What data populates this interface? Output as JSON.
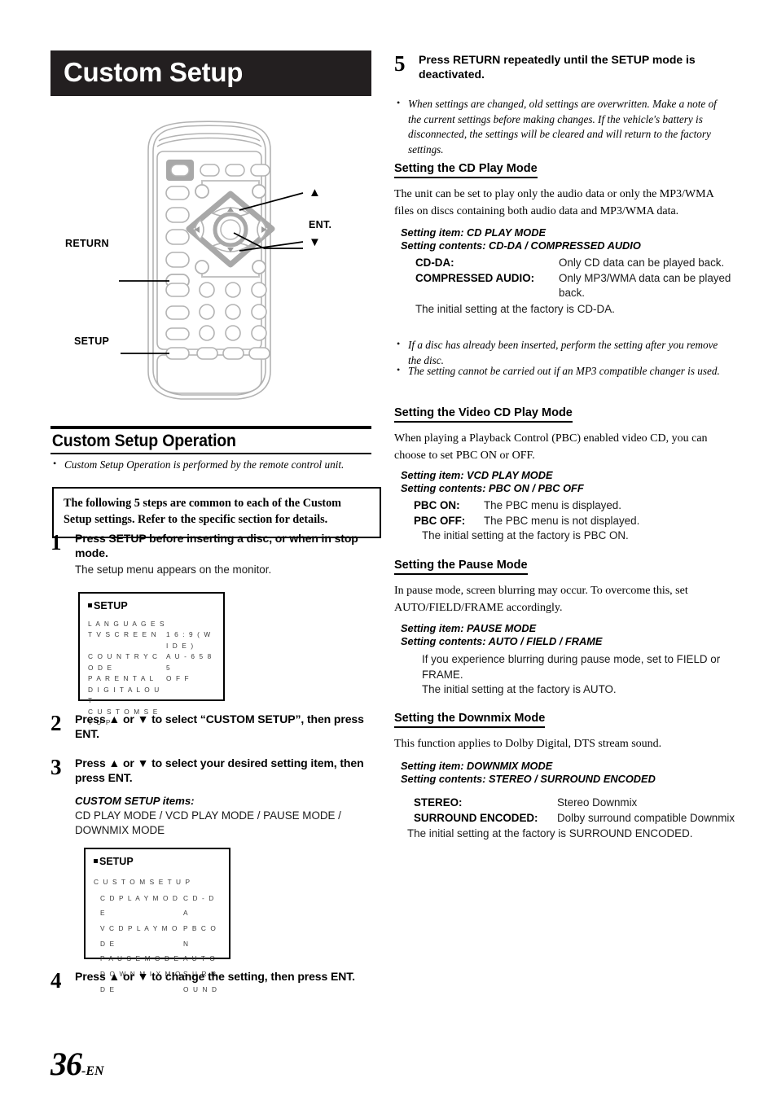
{
  "page": {
    "title": "Custom Setup",
    "page_number": "36",
    "page_suffix": "-EN"
  },
  "remote_diagram": {
    "labels": {
      "return": "RETURN",
      "setup": "SETUP",
      "up": "▲",
      "ent": "ENT.",
      "down": "▼"
    }
  },
  "section": {
    "heading": "Custom Setup Operation",
    "intro_note": "Custom Setup Operation is performed by the remote control unit.",
    "boxed_note": "The following 5 steps are common to each of the Custom Setup settings. Refer to the specific section for details."
  },
  "steps": [
    {
      "num": "1",
      "heading": "Press SETUP before inserting a disc, or when in stop mode.",
      "sub": "The setup menu appears on the monitor."
    },
    {
      "num": "2",
      "heading": "Press ▲ or ▼ to select “CUSTOM SETUP”, then press ENT."
    },
    {
      "num": "3",
      "heading": "Press ▲ or ▼ to select your desired setting item, then press ENT.",
      "items_label": "CUSTOM SETUP items:",
      "items": "CD PLAY MODE / VCD PLAY MODE / PAUSE MODE / DOWNMIX MODE"
    },
    {
      "num": "4",
      "heading": "Press ▲ or ▼ to change the setting, then press ENT."
    },
    {
      "num": "5",
      "heading": "Press RETURN repeatedly until the SETUP mode is deactivated."
    }
  ],
  "osd_screen_1": {
    "title": "SETUP",
    "rows": [
      {
        "key": "L A N G U A G E S",
        "value": ""
      },
      {
        "key": "T V  S C R E E N",
        "value": "1 6 : 9 ( W I D E )"
      },
      {
        "key": "C O U N T R Y  C O D E",
        "value": "A U - 6 5 8 5"
      },
      {
        "key": "P A R E N T A L",
        "value": "O F F"
      },
      {
        "key": "D I G I T A L  O U T",
        "value": ""
      },
      {
        "key": "C U S T O M  S E T U P",
        "value": ""
      }
    ]
  },
  "osd_screen_2": {
    "title": "SETUP",
    "group": "C U S T O M  S E T U P",
    "rows": [
      {
        "key": "C D  P L A Y  M O D E",
        "value": "C D - D A"
      },
      {
        "key": "V C D  P L A Y  M O D E",
        "value": "P B C  O N"
      },
      {
        "key": "P A U S E  M O D E",
        "value": "A U T O"
      },
      {
        "key": "D O W N M I X  M O D E",
        "value": "S U R R O U N D"
      }
    ]
  },
  "right_column": {
    "step5_note": "When settings are changed, old settings are overwritten. Make a note of the current settings before making changes. If the vehicle's battery is disconnected, the settings will be cleared and will return to the factory settings.",
    "cd_play": {
      "heading": "Setting the CD Play Mode",
      "body": "The unit can be set to play only the audio data or only the MP3/WMA files on discs containing both audio data and MP3/WMA data.",
      "setting_item": "Setting item: CD PLAY MODE",
      "setting_contents": "Setting contents: CD-DA / COMPRESSED AUDIO",
      "def1_term": "CD-DA:",
      "def1_desc": "Only CD data can be played back.",
      "def2_term": "COMPRESSED AUDIO:",
      "def2_desc": "Only MP3/WMA data can be played back.",
      "initial": "The initial setting at the factory is CD-DA.",
      "note1": "If a disc has already been inserted, perform the setting after you remove the disc.",
      "note2": "The setting cannot be carried out if an MP3 compatible changer is used."
    },
    "vcd_play": {
      "heading": "Setting the Video CD Play Mode",
      "body": "When playing a Playback Control (PBC) enabled video CD, you can choose to set PBC ON or OFF.",
      "setting_item": "Setting item: VCD PLAY MODE",
      "setting_contents": "Setting contents: PBC ON / PBC OFF",
      "def1_term": "PBC ON:",
      "def1_desc": "The PBC menu is displayed.",
      "def2_term": "PBC OFF:",
      "def2_desc": "The PBC menu is not displayed.",
      "initial": "The initial setting at the factory is PBC ON."
    },
    "pause": {
      "heading": "Setting the Pause Mode",
      "body": "In pause mode, screen blurring may occur. To overcome this, set AUTO/FIELD/FRAME accordingly.",
      "setting_item": "Setting item: PAUSE MODE",
      "setting_contents": "Setting contents: AUTO / FIELD / FRAME",
      "line1": "If you experience blurring during pause mode, set to FIELD or FRAME.",
      "initial": "The initial setting at the factory is AUTO."
    },
    "downmix": {
      "heading": "Setting the Downmix Mode",
      "body": "This function applies to Dolby Digital, DTS stream sound.",
      "setting_item": "Setting item: DOWNMIX MODE",
      "setting_contents": "Setting contents: STEREO / SURROUND ENCODED",
      "def1_term": "STEREO:",
      "def1_desc": "Stereo Downmix",
      "def2_term": "SURROUND ENCODED:",
      "def2_desc": "Dolby surround compatible Downmix",
      "initial": "The initial setting at the factory is SURROUND ENCODED."
    }
  }
}
